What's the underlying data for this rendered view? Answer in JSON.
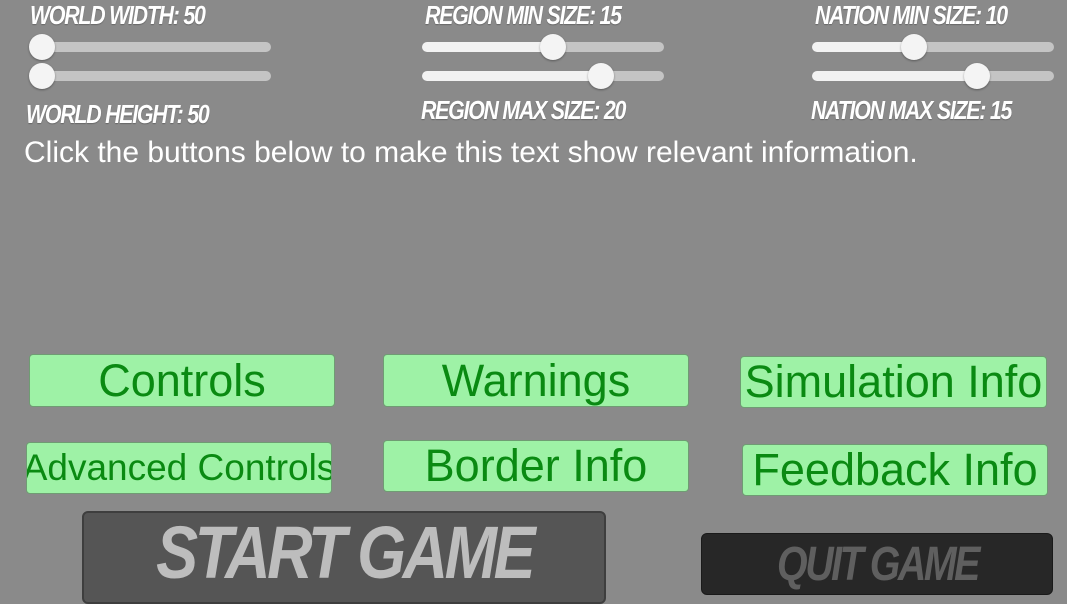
{
  "settings": {
    "world_width": {
      "label": "WORLD WIDTH: 50",
      "value": 0
    },
    "world_height": {
      "label": "WORLD HEIGHT: 50",
      "value": 0
    },
    "region_min": {
      "label": "REGION MIN SIZE: 15",
      "value": 0.54
    },
    "region_max": {
      "label": "REGION MAX SIZE: 20",
      "value": 0.74
    },
    "nation_min": {
      "label": "NATION MIN SIZE: 10",
      "value": 0.42
    },
    "nation_max": {
      "label": "NATION MAX SIZE: 15",
      "value": 0.68
    }
  },
  "info": {
    "text": "Click the buttons below to make this text show relevant information."
  },
  "buttons": {
    "controls": "Controls",
    "warnings": "Warnings",
    "simulation_info": "Simulation Info",
    "advanced_controls": "Advanced Controls",
    "border_info": "Border Info",
    "feedback_info": "Feedback Info",
    "start_game": "START GAME",
    "quit_game": "QUIT GAME"
  },
  "colors": {
    "background": "#8a8a8a",
    "button_green": "#9ef2a6",
    "button_text_green": "#0a8a12",
    "start_button": "#555555",
    "quit_button": "#272727"
  }
}
